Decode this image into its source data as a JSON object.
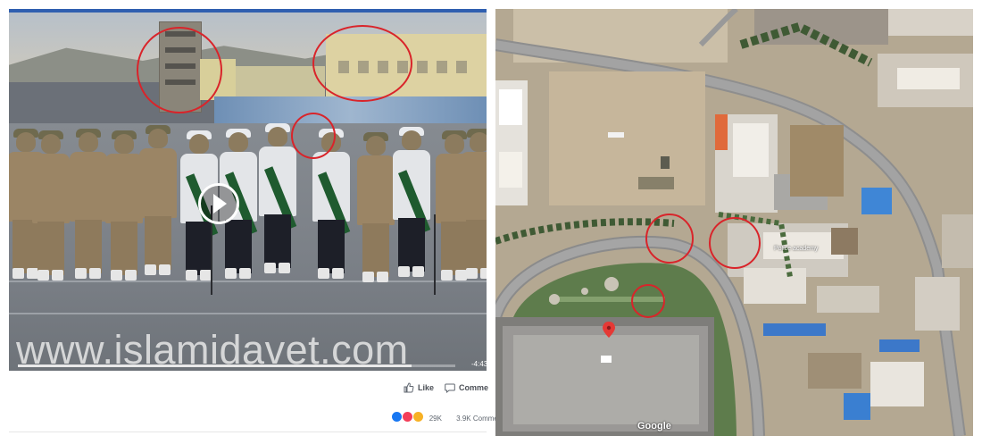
{
  "post": {
    "watermark": "www.islamidavet.com",
    "video_time": "-4:43",
    "video_progress": 0.9,
    "like_label": "Like",
    "comment_label": "Comme",
    "reaction_count": "29K",
    "comment_count": "3.9K Comme",
    "colors": {
      "like": "#1877f2",
      "love": "#f33e58",
      "sad": "#f7b125",
      "annotation": "#d9242a"
    }
  },
  "map": {
    "attribution": "Google",
    "poi_label": "Police academy"
  }
}
